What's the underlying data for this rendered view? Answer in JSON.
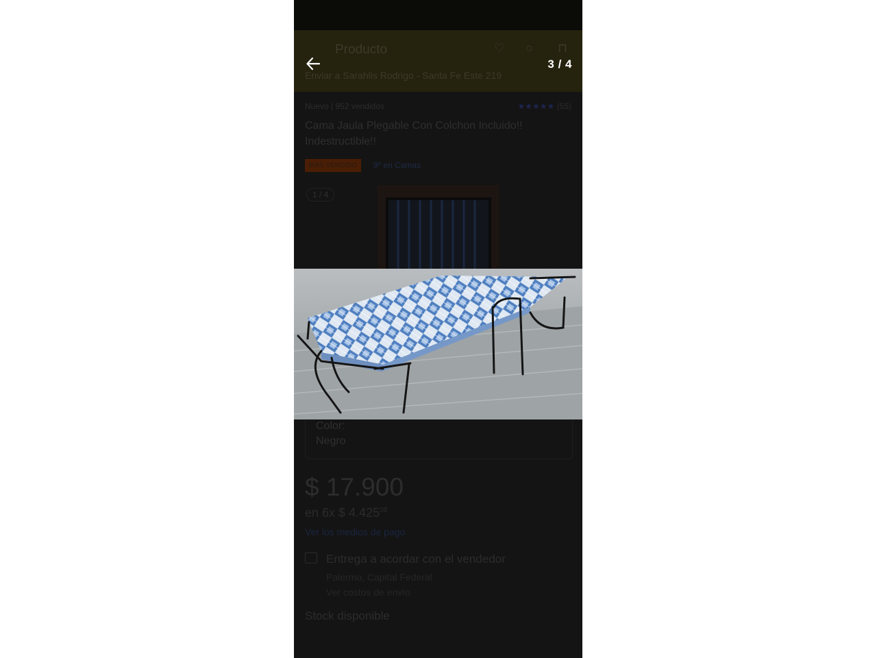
{
  "overlay": {
    "counter": "3 / 4",
    "back_icon": "arrow-left-icon"
  },
  "appbar": {
    "title": "Producto",
    "shipping": "Enviar a Sarahlis Rodrigo - Santa Fe Este 219"
  },
  "product": {
    "condition_sales": "Nuevo | 952 vendidos",
    "rating_count": "(55)",
    "title": "Cama Jaula Plegable Con Colchon Incluido!! Indestructible!!",
    "badge": "MÁS VENDIDO",
    "rank": "9º en Camas",
    "thumb_counter": "1 / 4",
    "color_label": "Color:",
    "color_value": "Negro",
    "price": "$ 17.900",
    "installments": "en 6x $ 4.425",
    "installments_sup": "08",
    "payment_link": "Ver los medios de pago",
    "delivery": "Entrega a acordar con el vendedor",
    "location": "Palermo, Capital Federal",
    "costs": "Ver costos de envío",
    "stock": "Stock disponible"
  },
  "colors": {
    "overlay_bg": "#141414",
    "appbar_bg": "#25220e",
    "counter_text": "#ffffff",
    "mattress_blue": "#5b86c4"
  }
}
